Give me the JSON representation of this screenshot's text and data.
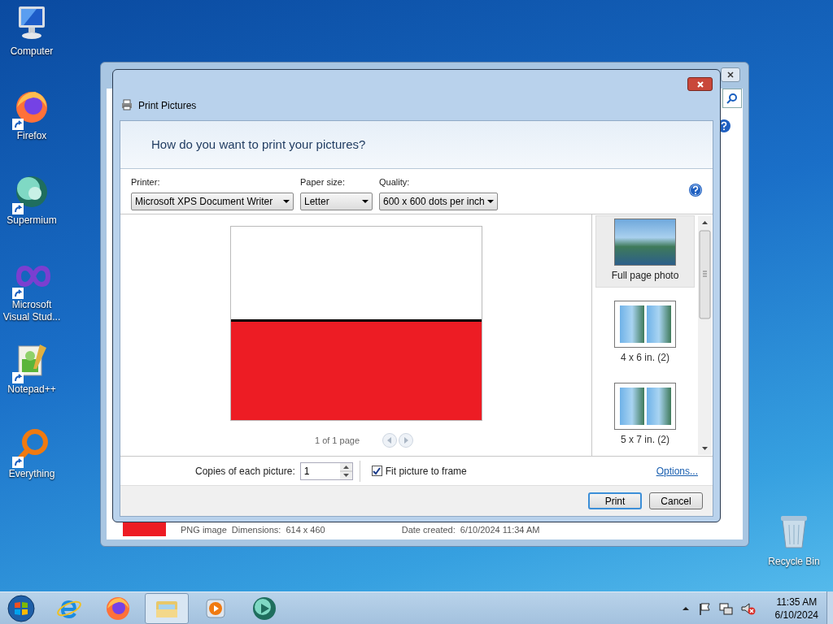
{
  "desktop_icons": [
    {
      "label": "Computer",
      "kind": "computer"
    },
    {
      "label": "Firefox",
      "kind": "firefox"
    },
    {
      "label": "Supermium",
      "kind": "supermium"
    },
    {
      "label": "Microsoft Visual Stud...",
      "kind": "vs"
    },
    {
      "label": "Notepad++",
      "kind": "notepad"
    },
    {
      "label": "Everything",
      "kind": "everything"
    }
  ],
  "recycle_bin": {
    "label": "Recycle Bin"
  },
  "background_window": {
    "details": [
      "PNG image",
      "Dimensions:",
      "614 x 460",
      "Date created:",
      "6/10/2024 11:34 AM"
    ]
  },
  "dialog": {
    "title": "Print Pictures",
    "heading": "How do you want to print your pictures?",
    "fields": [
      {
        "label": "Printer:",
        "value": "Microsoft XPS Document Writer"
      },
      {
        "label": "Paper size:",
        "value": "Letter"
      },
      {
        "label": "Quality:",
        "value": "600 x 600 dots per inch"
      }
    ],
    "preview": {
      "page_info": "1 of 1 page"
    },
    "layouts": [
      {
        "label": "Full page photo",
        "kind": "full",
        "selected": true
      },
      {
        "label": "4 x 6 in. (2)",
        "kind": "two",
        "selected": false
      },
      {
        "label": "5 x 7 in. (2)",
        "kind": "two",
        "selected": false
      }
    ],
    "copies": {
      "label": "Copies of each picture:",
      "value": "1"
    },
    "fit": {
      "label": "Fit picture to frame",
      "checked": true
    },
    "options_link": "Options...",
    "buttons": [
      {
        "label": "Print",
        "default": true
      },
      {
        "label": "Cancel",
        "default": false
      }
    ]
  },
  "taskbar": {
    "items": [
      {
        "kind": "ie",
        "active": false
      },
      {
        "kind": "firefox",
        "active": false
      },
      {
        "kind": "explorer",
        "active": true
      },
      {
        "kind": "media",
        "active": false
      },
      {
        "kind": "supermium",
        "active": false
      }
    ],
    "time": "11:35 AM",
    "date": "6/10/2024"
  }
}
